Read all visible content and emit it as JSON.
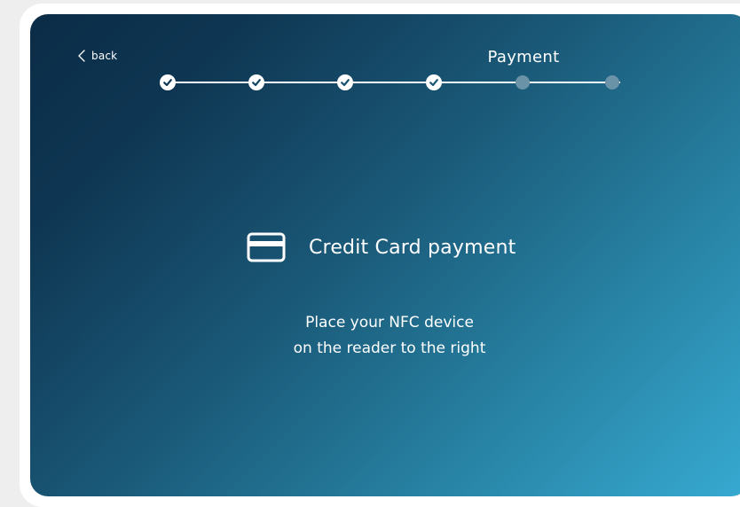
{
  "nav": {
    "back_label": "back",
    "back_icon": "chevron-left-icon"
  },
  "header": {
    "step_title": "Payment"
  },
  "stepper": {
    "steps": [
      {
        "status": "completed"
      },
      {
        "status": "completed"
      },
      {
        "status": "completed"
      },
      {
        "status": "completed"
      },
      {
        "status": "pending"
      },
      {
        "status": "pending"
      }
    ],
    "current_step": 5,
    "total_steps": 6
  },
  "payment": {
    "icon": "credit-card-icon",
    "title": "Credit Card payment",
    "instruction_line1": "Place your NFC device",
    "instruction_line2": "on the reader to the right"
  },
  "colors": {
    "gradient_start": "#0b2c47",
    "gradient_end": "#37aad2",
    "pending_step": "#6b93a8",
    "text": "#ffffff"
  }
}
